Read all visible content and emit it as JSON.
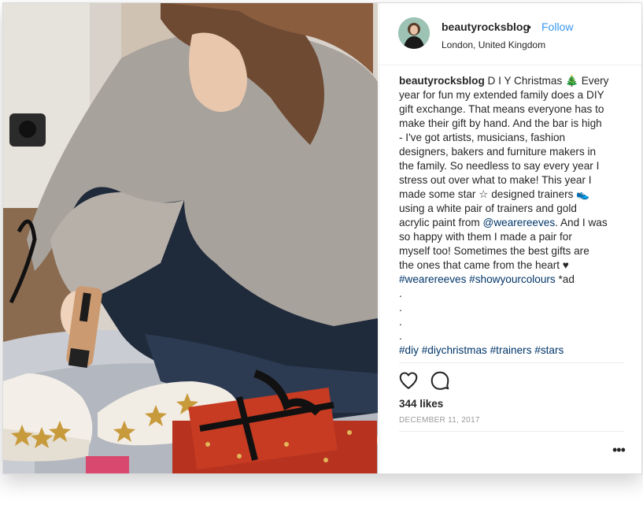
{
  "post": {
    "username": "beautyrocksblog",
    "separator_dot": "•",
    "follow_label": "Follow",
    "location": "London, United Kingdom",
    "caption": {
      "username": "beautyrocksblog",
      "lines": [
        " D I Y Christmas 🎄 Every",
        "year for fun my extended family does a DIY",
        "gift exchange. That means everyone has to",
        "make their gift by hand. And the bar is high",
        "- I've got artists, musicians, fashion",
        "designers, bakers and furniture makers in",
        "the family. So needless to say every year I",
        "stress out over what to make! This year I",
        "made some star ☆ designed trainers 👟",
        "using a white pair of trainers and gold",
        "acrylic paint from ",
        ". And I was",
        "so happy with them I made a pair for",
        "myself too! Sometimes the best gifts are",
        "the ones that came from the heart ♥",
        " *ad",
        ".",
        ".",
        ".",
        "."
      ],
      "mention": "@wearereeves",
      "hashtags_line1": [
        "#wearereeves",
        "#showyourcolours"
      ],
      "hashtags_line2": [
        "#diy",
        "#diychristmas",
        "#trainers",
        "#stars"
      ]
    },
    "likes": "344 likes",
    "date": "DECEMBER 11, 2017",
    "more_label": "•••",
    "icons": {
      "like": "heart-icon",
      "comment": "comment-icon"
    },
    "colors": {
      "link_blue": "#3897f0",
      "hashtag_blue": "#003569",
      "text": "#262626",
      "muted": "#999999"
    }
  }
}
